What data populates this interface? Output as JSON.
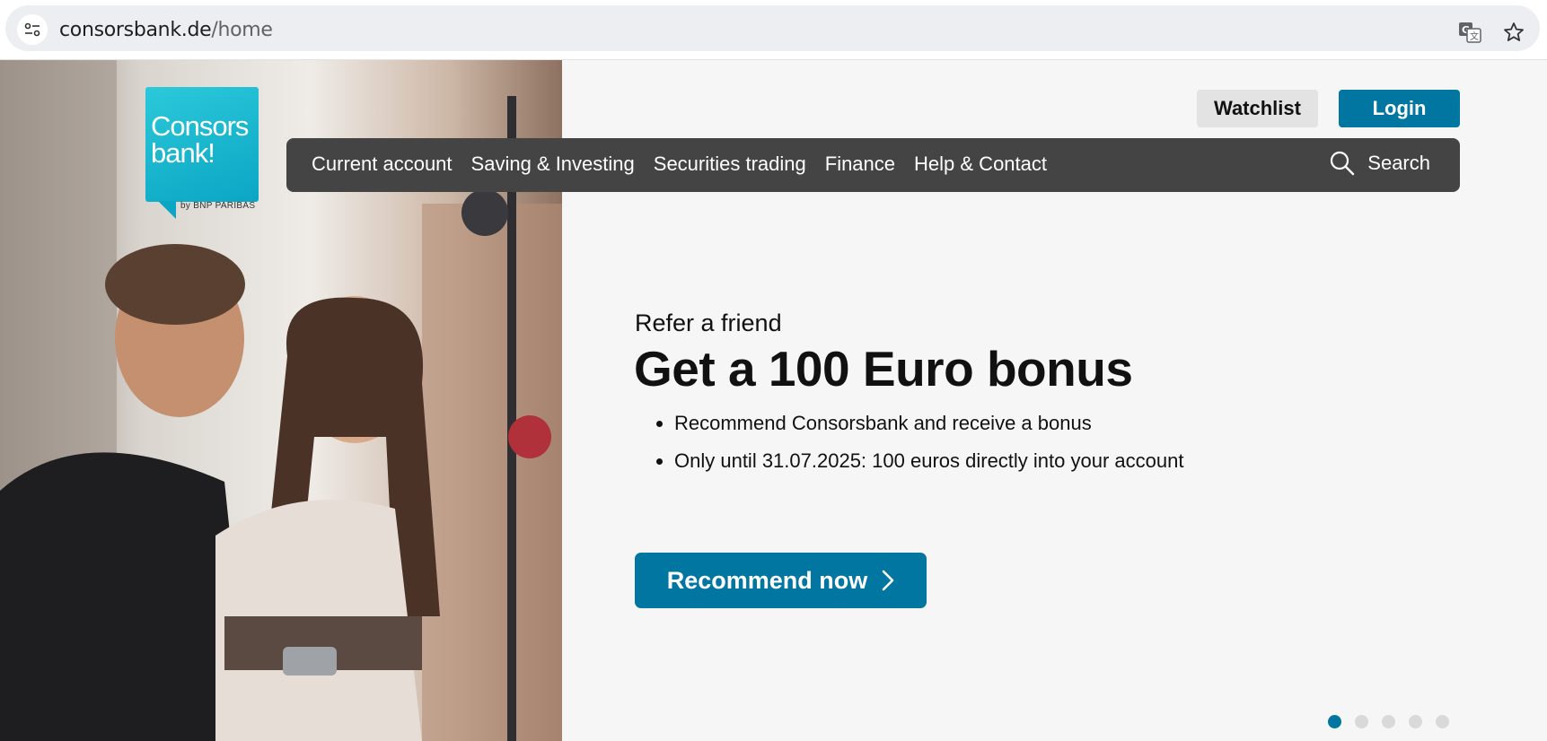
{
  "browser": {
    "url_host": "consorsbank.de",
    "url_path": "/home"
  },
  "logo": {
    "line1": "Consors",
    "line2": "bank!",
    "byline": "by BNP PARIBAS"
  },
  "header": {
    "watchlist_label": "Watchlist",
    "login_label": "Login"
  },
  "nav": {
    "items": [
      {
        "label": "Current account"
      },
      {
        "label": "Saving & Investing"
      },
      {
        "label": "Securities trading"
      },
      {
        "label": "Finance"
      },
      {
        "label": "Help & Contact"
      }
    ],
    "search_label": "Search"
  },
  "hero": {
    "eyebrow": "Refer a friend",
    "headline": "Get a 100 Euro bonus",
    "bullets": [
      "Recommend Consorsbank and receive a bonus",
      "Only until 31.07.2025: 100 euros directly into your account"
    ],
    "cta_label": "Recommend now"
  },
  "carousel": {
    "slide_count": 5,
    "active_index": 0
  },
  "colors": {
    "brand_blue": "#0076a0",
    "logo_cyan": "#0aa6c4",
    "nav_bg": "#444444"
  }
}
